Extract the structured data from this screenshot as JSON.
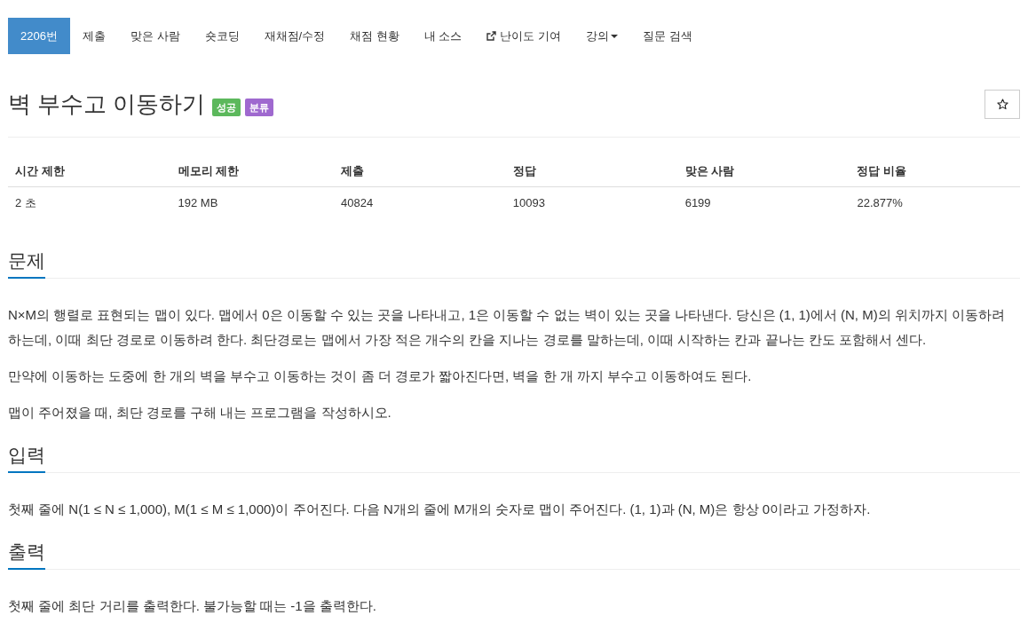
{
  "nav": {
    "tabs": [
      {
        "label": "2206번",
        "kind": "plain",
        "selected": true
      },
      {
        "label": "제출",
        "kind": "plain",
        "selected": false
      },
      {
        "label": "맞은 사람",
        "kind": "plain",
        "selected": false
      },
      {
        "label": "숏코딩",
        "kind": "plain",
        "selected": false
      },
      {
        "label": "재채점/수정",
        "kind": "plain",
        "selected": false
      },
      {
        "label": "채점 현황",
        "kind": "plain",
        "selected": false
      },
      {
        "label": "내 소스",
        "kind": "plain",
        "selected": false
      },
      {
        "label": "난이도 기여",
        "kind": "external",
        "selected": false
      },
      {
        "label": "강의",
        "kind": "dropdown",
        "selected": false
      },
      {
        "label": "질문 검색",
        "kind": "plain",
        "selected": false
      }
    ]
  },
  "problem": {
    "title": "벽 부수고 이동하기",
    "tags": [
      {
        "text": "성공",
        "color": "#5cb85c"
      },
      {
        "text": "분류",
        "color": "#9f69cf"
      }
    ]
  },
  "info_table": {
    "columns": [
      "시간 제한",
      "메모리 제한",
      "제출",
      "정답",
      "맞은 사람",
      "정답 비율"
    ],
    "rows": [
      [
        "2 초",
        "192 MB",
        "40824",
        "10093",
        "6199",
        "22.877%"
      ]
    ]
  },
  "sections": [
    {
      "heading": "문제",
      "paragraphs": [
        "N×M의 행렬로 표현되는 맵이 있다. 맵에서 0은 이동할 수 있는 곳을 나타내고, 1은 이동할 수 없는 벽이 있는 곳을 나타낸다. 당신은 (1, 1)에서 (N, M)의 위치까지 이동하려 하는데, 이때 최단 경로로 이동하려 한다. 최단경로는 맵에서 가장 적은 개수의 칸을 지나는 경로를 말하는데, 이때 시작하는 칸과 끝나는 칸도 포함해서 센다.",
        "만약에 이동하는 도중에 한 개의 벽을 부수고 이동하는 것이 좀 더 경로가 짧아진다면, 벽을 한 개 까지 부수고 이동하여도 된다.",
        "맵이 주어졌을 때, 최단 경로를 구해 내는 프로그램을 작성하시오."
      ]
    },
    {
      "heading": "입력",
      "paragraphs": [
        "첫째 줄에 N(1 ≤ N ≤ 1,000), M(1 ≤ M ≤ 1,000)이 주어진다. 다음 N개의 줄에 M개의 숫자로 맵이 주어진다. (1, 1)과 (N, M)은 항상 0이라고 가정하자."
      ]
    },
    {
      "heading": "출력",
      "paragraphs": [
        "첫째 줄에 최단 거리를 출력한다. 불가능할 때는 -1을 출력한다."
      ]
    }
  ]
}
